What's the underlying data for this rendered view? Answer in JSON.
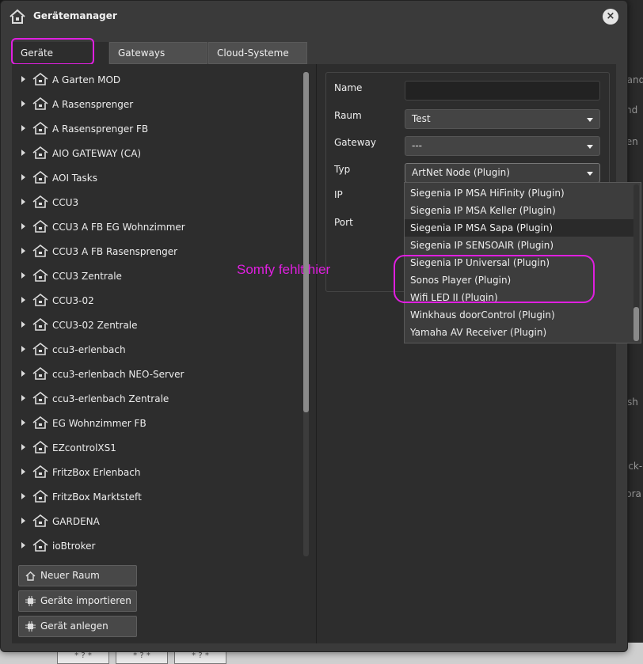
{
  "background": {
    "fragments": [
      "nandfe",
      "nd",
      "ten",
      "sh",
      "ick-",
      "bra"
    ],
    "cells": [
      "* ? *",
      "* ? *",
      "* ? *"
    ]
  },
  "dialog": {
    "title": "Gerätemanager",
    "close_label": "×",
    "tabs": [
      "Geräte",
      "Gateways",
      "Cloud-Systeme"
    ],
    "active_tab": "Geräte"
  },
  "devices": [
    "A Garten MOD",
    "A Rasensprenger",
    "A Rasensprenger FB",
    "AIO GATEWAY (CA)",
    "AOI Tasks",
    "CCU3",
    "CCU3 A FB EG Wohnzimmer",
    "CCU3 A FB Rasensprenger",
    "CCU3 Zentrale",
    "CCU3-02",
    "CCU3-02 Zentrale",
    "ccu3-erlenbach",
    "ccu3-erlenbach NEO-Server",
    "ccu3-erlenbach Zentrale",
    "EG Wohnzimmer FB",
    "EZcontrolXS1",
    "FritzBox Erlenbach",
    "FritzBox Marktsteft",
    "GARDENA",
    "ioBtroker"
  ],
  "buttons": {
    "new_room": "Neuer Raum",
    "import_devices": "Geräte importieren",
    "create_device": "Gerät anlegen"
  },
  "form": {
    "name_label": "Name",
    "name_value": "",
    "room_label": "Raum",
    "room_value": "Test",
    "gateway_label": "Gateway",
    "gateway_value": "---",
    "type_label": "Typ",
    "type_value": "ArtNet Node (Plugin)",
    "ip_label": "IP",
    "port_label": "Port"
  },
  "type_dropdown": {
    "options": [
      "Siegenia IP MSA HiFinity (Plugin)",
      "Siegenia IP MSA Keller (Plugin)",
      "Siegenia IP MSA Sapa (Plugin)",
      "Siegenia IP SENSOAIR (Plugin)",
      "Siegenia IP Universal (Plugin)",
      "Sonos Player (Plugin)",
      "Wifi LED II (Plugin)",
      "Winkhaus doorControl (Plugin)",
      "Yamaha AV Receiver (Plugin)"
    ],
    "highlighted": "Siegenia IP MSA Sapa (Plugin)"
  },
  "annotation": {
    "text": "Somfy fehlt hier",
    "color": "#e01fe0"
  }
}
